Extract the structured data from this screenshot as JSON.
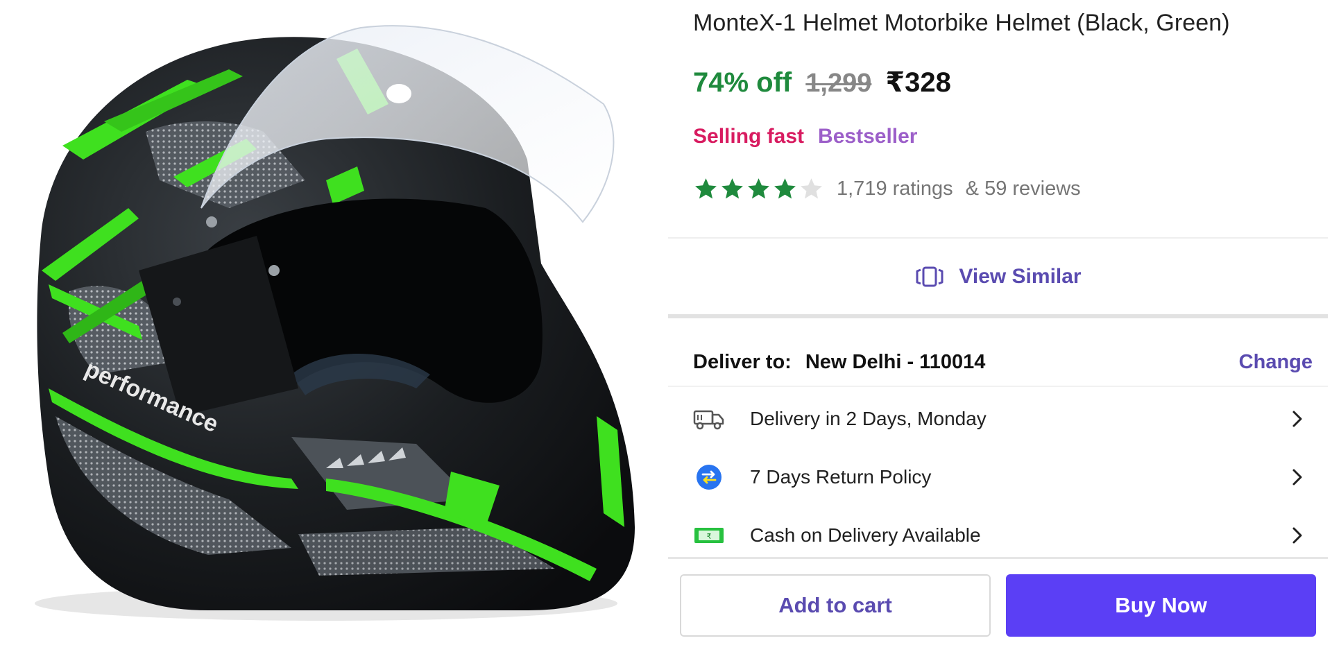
{
  "product": {
    "title": "MonteX-1 Helmet Motorbike Helmet (Black, Green)",
    "image_alt": "helmet-product-image",
    "helmet_decal_text": "performance"
  },
  "pricing": {
    "discount": "74% off",
    "mrp": "1,299",
    "price": "₹328"
  },
  "tags": {
    "urgency": "Selling fast",
    "badge": "Bestseller"
  },
  "rating": {
    "stars_filled": 4,
    "stars_total": 5,
    "ratings_text": "1,719 ratings",
    "reviews_text": "& 59 reviews"
  },
  "view_similar": {
    "label": "View Similar",
    "icon": "view-similar-icon"
  },
  "delivery": {
    "label": "Deliver to:",
    "location": "New Delhi - 110014",
    "change_label": "Change"
  },
  "info_items": [
    {
      "label": "Delivery in 2 Days, Monday",
      "icon": "truck-icon"
    },
    {
      "label": "7 Days Return Policy",
      "icon": "return-icon"
    },
    {
      "label": "Cash on Delivery Available",
      "icon": "cash-icon"
    }
  ],
  "actions": {
    "add_to_cart": "Add to cart",
    "buy_now": "Buy Now"
  },
  "colors": {
    "accent": "#5b3ff5",
    "link": "#5a4bb0",
    "discount": "#1f8a3d",
    "selling_fast": "#d81b60",
    "bestseller": "#9c5fc9",
    "star_filled": "#1f8a3d",
    "star_empty": "#e0e0e0"
  }
}
